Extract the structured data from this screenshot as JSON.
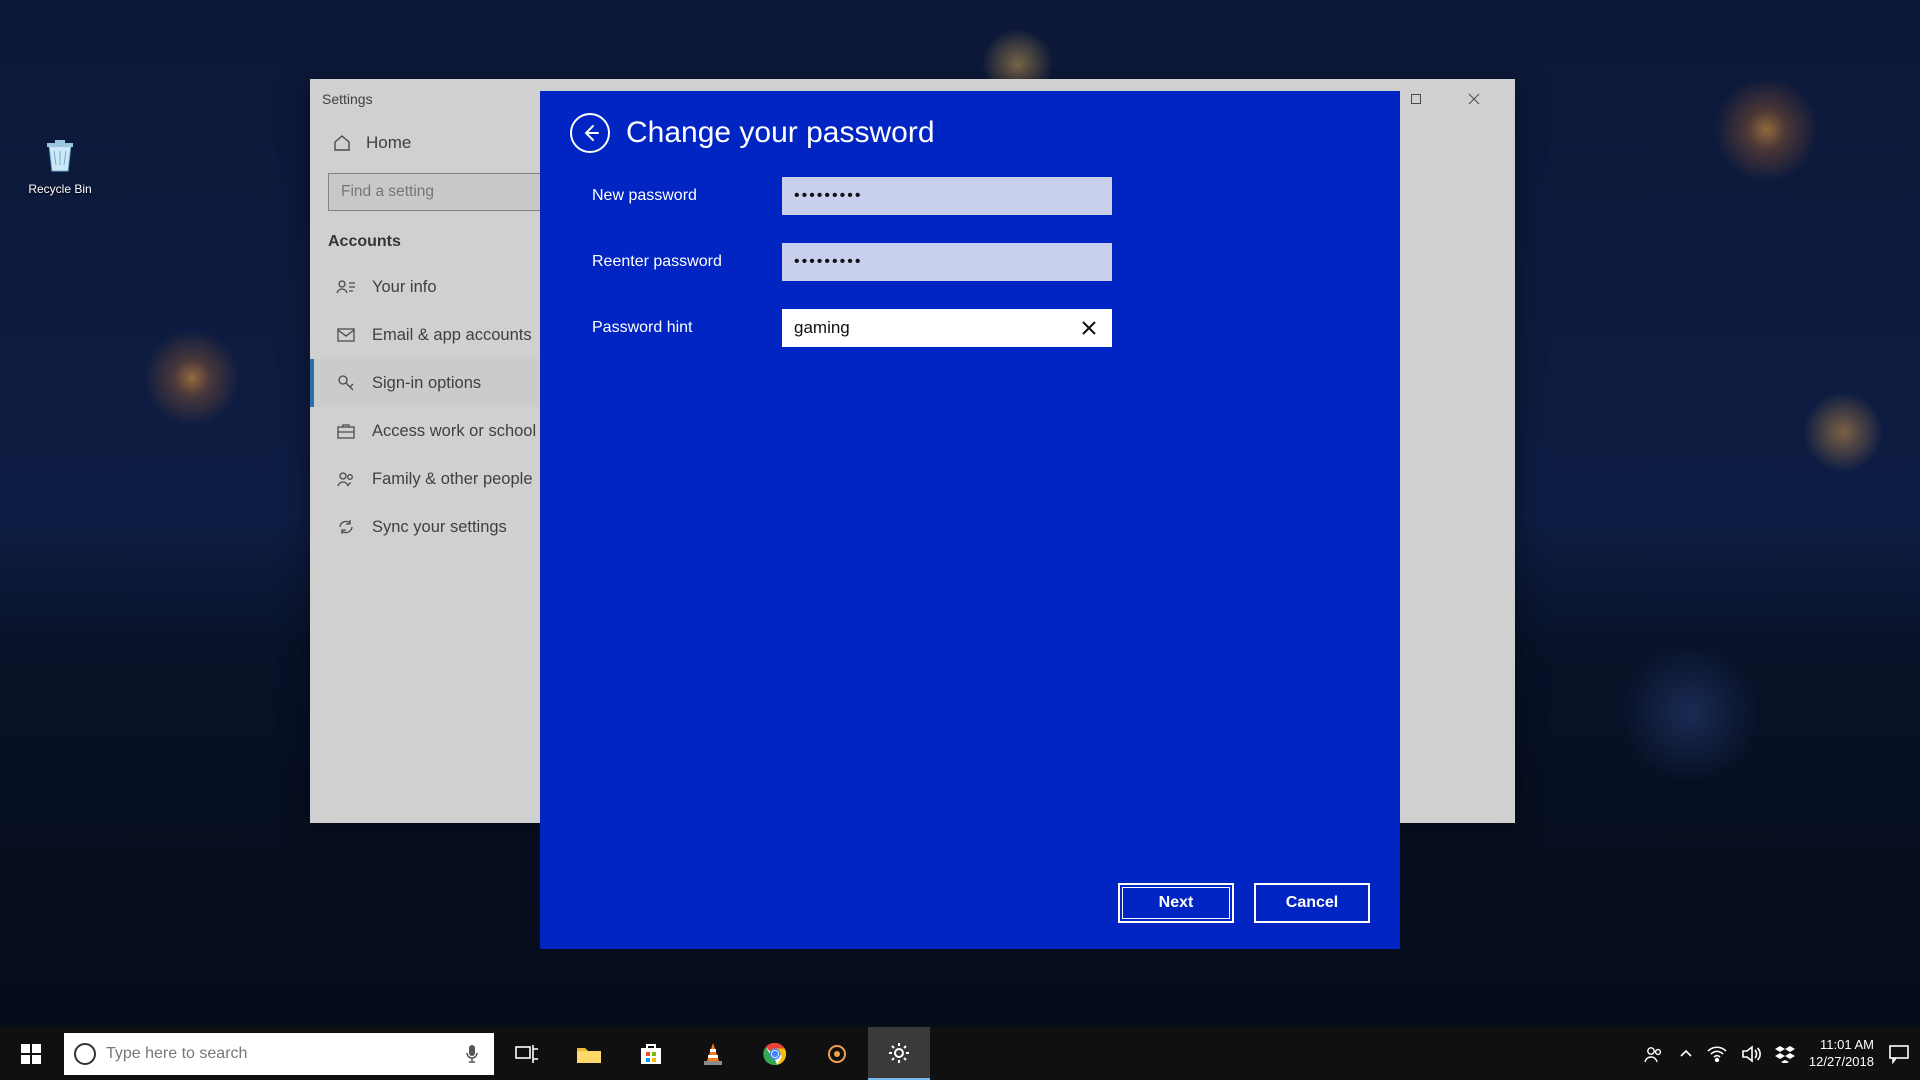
{
  "desktop": {
    "recycle_bin": "Recycle Bin"
  },
  "settings_window": {
    "title": "Settings",
    "home": "Home",
    "search_placeholder": "Find a setting",
    "section": "Accounts",
    "nav": {
      "your_info": "Your info",
      "email": "Email & app accounts",
      "signin": "Sign-in options",
      "work": "Access work or school",
      "family": "Family & other people",
      "sync": "Sync your settings"
    }
  },
  "modal": {
    "title": "Change your password",
    "labels": {
      "new_password": "New password",
      "reenter": "Reenter password",
      "hint": "Password hint"
    },
    "values": {
      "new_password": "•••••••••",
      "reenter": "•••••••••",
      "hint": "gaming"
    },
    "buttons": {
      "next": "Next",
      "cancel": "Cancel"
    }
  },
  "taskbar": {
    "search_placeholder": "Type here to search",
    "time": "11:01 AM",
    "date": "12/27/2018"
  }
}
